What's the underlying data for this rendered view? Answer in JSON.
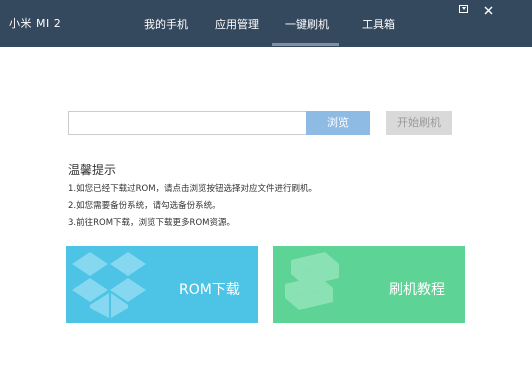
{
  "window": {
    "device_name": "小米 MI 2",
    "menu_icon": "menu-dropdown-icon",
    "close_icon": "close-icon"
  },
  "nav": {
    "items": [
      {
        "label": "我的手机"
      },
      {
        "label": "应用管理"
      },
      {
        "label": "一键刷机",
        "active": true
      },
      {
        "label": "工具箱"
      }
    ]
  },
  "rom_picker": {
    "path_value": "",
    "browse_label": "浏览",
    "flash_label": "开始刷机",
    "flash_enabled": false
  },
  "tips": {
    "title": "温馨提示",
    "lines": [
      "1.如您已经下载过ROM，请点击浏览按钮选择对应文件进行刷机。",
      "2.如您需要备份系统，请勾选备份系统。",
      "3.前往ROM下载，浏览下载更多ROM资源。"
    ]
  },
  "tiles": {
    "rom_download": {
      "label": "ROM下载",
      "icon": "dropbox-icon"
    },
    "flash_tutorial": {
      "label": "刷机教程",
      "icon": "books-icon"
    }
  },
  "colors": {
    "titlebar": "#35495e",
    "browse_button": "#8dbbe4",
    "flash_button_disabled": "#d9d9d9",
    "rom_tile": "#4dc3e6",
    "tutorial_tile": "#5dd396"
  }
}
